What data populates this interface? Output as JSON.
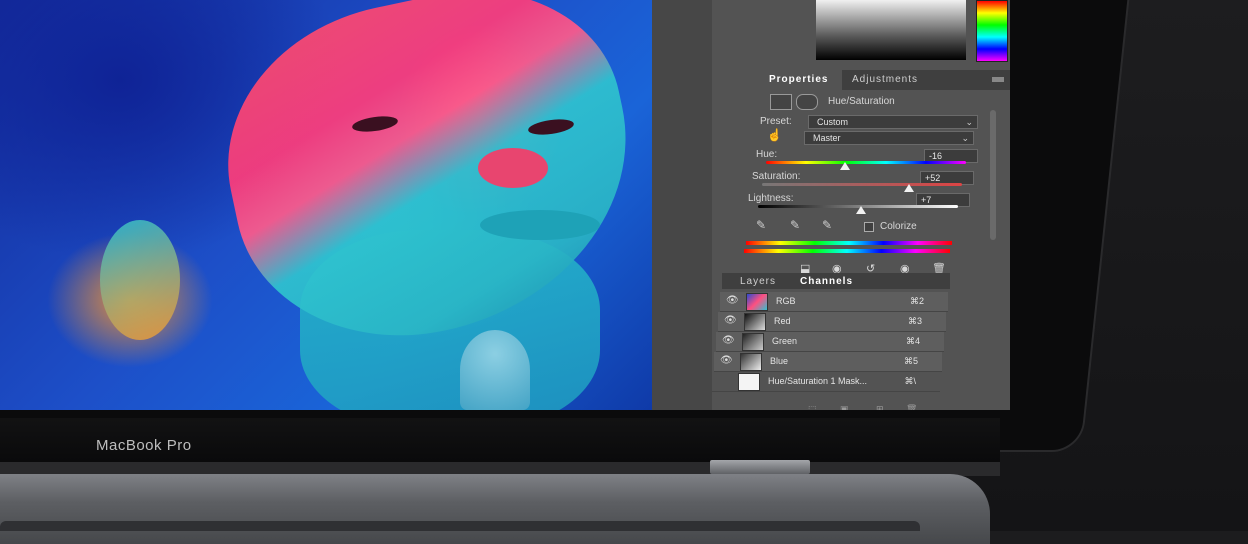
{
  "device": {
    "brand_label": "MacBook Pro"
  },
  "properties_panel": {
    "tabs": [
      {
        "label": "Properties",
        "active": true
      },
      {
        "label": "Adjustments",
        "active": false
      }
    ],
    "adjustment_title": "Hue/Saturation",
    "preset": {
      "label": "Preset:",
      "value": "Custom"
    },
    "channel_select": {
      "value": "Master"
    },
    "hue": {
      "label": "Hue:",
      "value": "-16"
    },
    "saturation": {
      "label": "Saturation:",
      "value": "+52"
    },
    "lightness": {
      "label": "Lightness:",
      "value": "+7"
    },
    "colorize": {
      "label": "Colorize",
      "checked": false
    }
  },
  "layers_panel": {
    "tabs": [
      {
        "label": "Layers",
        "active": false
      },
      {
        "label": "Channels",
        "active": true
      }
    ],
    "channels": [
      {
        "name": "RGB",
        "shortcut": "⌘2",
        "visible": true,
        "selected": true
      },
      {
        "name": "Red",
        "shortcut": "⌘3",
        "visible": true,
        "selected": true
      },
      {
        "name": "Green",
        "shortcut": "⌘4",
        "visible": true,
        "selected": true
      },
      {
        "name": "Blue",
        "shortcut": "⌘5",
        "visible": true,
        "selected": true
      },
      {
        "name": "Hue/Saturation 1 Mask...",
        "shortcut": "⌘\\",
        "visible": false,
        "selected": false
      }
    ]
  },
  "icons": {
    "eye": "eye-icon",
    "trash": "trash-icon",
    "reset": "reset-icon",
    "clip": "clip-icon",
    "view": "view-icon",
    "target": "hand-target-icon",
    "eyedropper": "eyedropper-icon"
  },
  "colors": {
    "panel_bg": "#535353",
    "tab_bar_bg": "#3f3f3f",
    "field_bg": "#3c3c3c"
  }
}
